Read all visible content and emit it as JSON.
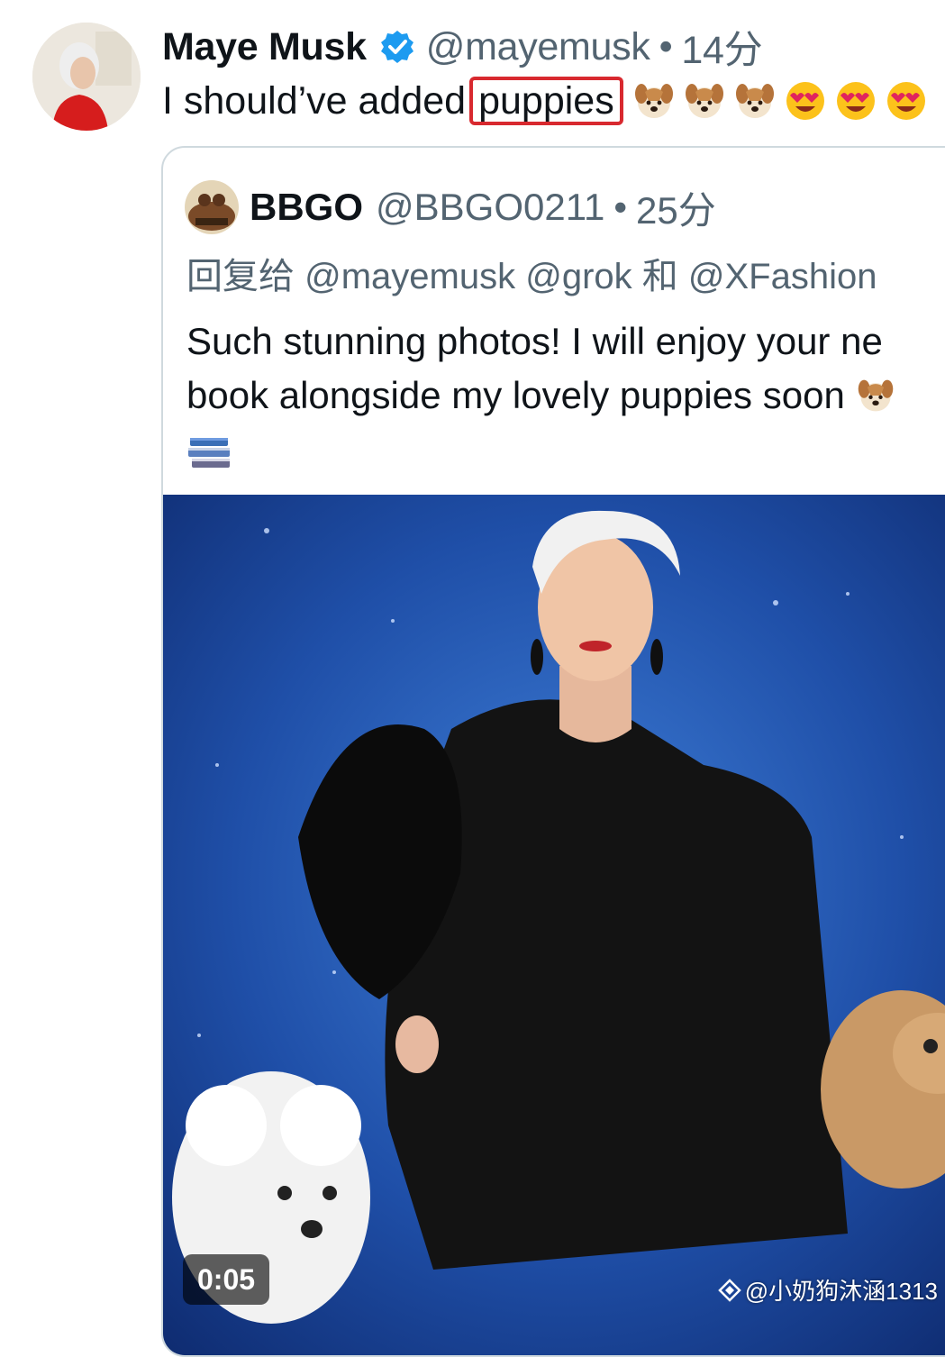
{
  "main_tweet": {
    "display_name": "Maye Musk",
    "handle": "@mayemusk",
    "separator": "•",
    "time": "14分",
    "text_before": "I should’ve added",
    "highlighted_word": "puppies",
    "emojis": [
      "dog-face-emoji",
      "dog-face-emoji",
      "dog-face-emoji",
      "heart-eyes-emoji",
      "heart-eyes-emoji",
      "heart-eyes-emoji"
    ],
    "highlight_color": "#d8292f",
    "verified_color": "#1d9bf0"
  },
  "quoted_tweet": {
    "display_name": "BBGO",
    "handle": "@BBGO0211",
    "separator": "•",
    "time": "25分",
    "reply_prefix": "回复给",
    "reply_mentions": "@mayemusk @grok 和 @XFashion",
    "body_line1": "Such stunning photos! I will enjoy your ne",
    "body_line2": "book alongside my lovely puppies soon",
    "trailing_emojis": [
      "dog-face-emoji",
      "books-icon"
    ],
    "video_duration": "0:05"
  },
  "watermark": {
    "text": "@小奶狗沐涵1313"
  },
  "colors": {
    "text_primary": "#0f1419",
    "text_secondary": "#536471",
    "border": "#cfd9de",
    "media_background": "#1b3f8c"
  }
}
